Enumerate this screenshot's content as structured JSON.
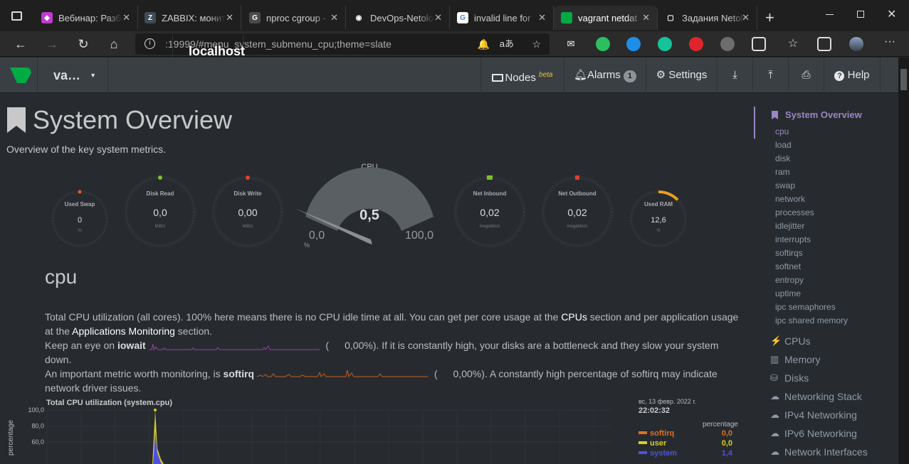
{
  "browser": {
    "tabs": [
      {
        "title": "Вебинар: Разбо",
        "color": "#c23ad1",
        "glyph": "◆"
      },
      {
        "title": "ZABBIX: монит",
        "color": "#3f4c57",
        "glyph": "Z"
      },
      {
        "title": "nproc cgroup -",
        "color": "#4b4b4b",
        "glyph": "G"
      },
      {
        "title": "DevOps-Netolo",
        "color": "#1f1f1f",
        "glyph": "◉"
      },
      {
        "title": "invalid line for",
        "color": "#ffffff",
        "glyph": "G"
      },
      {
        "title": "vagrant netdat",
        "color": "#00ab44",
        "glyph": ""
      },
      {
        "title": "Задания Netolo",
        "color": "#1f1f1f",
        "glyph": "▢"
      }
    ],
    "url_host": "localhost",
    "url_path": ":19999/#menu_system_submenu_cpu;theme=slate"
  },
  "header": {
    "host": "va…",
    "nodes": "Nodes",
    "nodes_beta": "beta",
    "alarms": "Alarms",
    "alarms_count": "1",
    "settings": "Settings",
    "help": "Help"
  },
  "page": {
    "title": "System Overview",
    "subtitle": "Overview of the key system metrics."
  },
  "gauges": {
    "used_swap": {
      "label": "Used Swap",
      "value": "0",
      "unit": "%",
      "dot": "#e05c2c"
    },
    "disk_read": {
      "label": "Disk Read",
      "value": "0,0",
      "unit": "MiB/s",
      "dot": "#7cc32a"
    },
    "disk_write": {
      "label": "Disk Write",
      "value": "0,00",
      "unit": "MiB/s",
      "dot": "#e0402c"
    },
    "cpu": {
      "label": "CPU",
      "value": "0,5",
      "min": "0,0",
      "max": "100,0",
      "unit": "%",
      "percent": 0.5
    },
    "net_inbound": {
      "label": "Net Inbound",
      "value": "0,02",
      "unit": "megabits/s",
      "dot": "#7cc32a"
    },
    "net_outbound": {
      "label": "Net Outbound",
      "value": "0,02",
      "unit": "megabits/s",
      "dot": "#e0402c"
    },
    "used_ram": {
      "label": "Used RAM",
      "value": "12,6",
      "unit": "%",
      "percent": 12.6,
      "arc_color": "#e8a020"
    }
  },
  "section": {
    "title": "cpu",
    "p1a": "Total CPU utilization (all cores). 100% here means there is no CPU idle time at all. You can get per core usage at the ",
    "p1_link1": "CPUs",
    "p1b": " section and per application usage",
    "p1c": "at the ",
    "p1_link2": "Applications Monitoring",
    "p1d": " section.",
    "p2a": "Keep an eye on ",
    "p2_bold": "iowait",
    "p2_value": "0,00%",
    "p2b": "). If it is constantly high, your disks are a bottleneck and they slow your system",
    "p2c": "down.",
    "p3a": "An important metric worth monitoring, is ",
    "p3_bold": "softirq",
    "p3_value": "0,00%",
    "p3b": "). A constantly high percentage of softirq may indicate",
    "p3c": "network driver issues."
  },
  "chart": {
    "title": "Total CPU utilization (system.cpu)",
    "date": "вс, 13 февр. 2022 г.",
    "time": "22:02:32",
    "legend_header": "percentage",
    "ylabel": "percentage",
    "ticks": [
      "100,0",
      "80,0",
      "60,0"
    ],
    "legend": [
      {
        "name": "softirq",
        "value": "0,0",
        "color": "#e07020"
      },
      {
        "name": "user",
        "value": "0,0",
        "color": "#d8d020"
      },
      {
        "name": "system",
        "value": "1,4",
        "color": "#5050e0"
      }
    ]
  },
  "chart_data": {
    "type": "area",
    "title": "Total CPU utilization (system.cpu)",
    "ylabel": "percentage",
    "ylim": [
      0,
      100
    ],
    "series": [
      {
        "name": "softirq",
        "value": 0.0
      },
      {
        "name": "user",
        "value": 0.0
      },
      {
        "name": "system",
        "value": 1.4
      }
    ],
    "peak": 100
  },
  "sidebar": {
    "head": "System Overview",
    "subs": [
      "cpu",
      "load",
      "disk",
      "ram",
      "swap",
      "network",
      "processes",
      "idlejitter",
      "interrupts",
      "softirqs",
      "softnet",
      "entropy",
      "uptime",
      "ipc semaphores",
      "ipc shared memory"
    ],
    "groups": [
      {
        "label": "CPUs",
        "icon": "bolt-icon",
        "glyph": "⚡"
      },
      {
        "label": "Memory",
        "icon": "memory-icon",
        "glyph": "▥"
      },
      {
        "label": "Disks",
        "icon": "disks-icon",
        "glyph": "⛁"
      },
      {
        "label": "Networking Stack",
        "icon": "cloud-icon",
        "glyph": "☁"
      },
      {
        "label": "IPv4 Networking",
        "icon": "cloud-icon",
        "glyph": "☁"
      },
      {
        "label": "IPv6 Networking",
        "icon": "cloud-icon",
        "glyph": "☁"
      },
      {
        "label": "Network Interfaces",
        "icon": "sitemap-icon",
        "glyph": "☁"
      }
    ]
  }
}
